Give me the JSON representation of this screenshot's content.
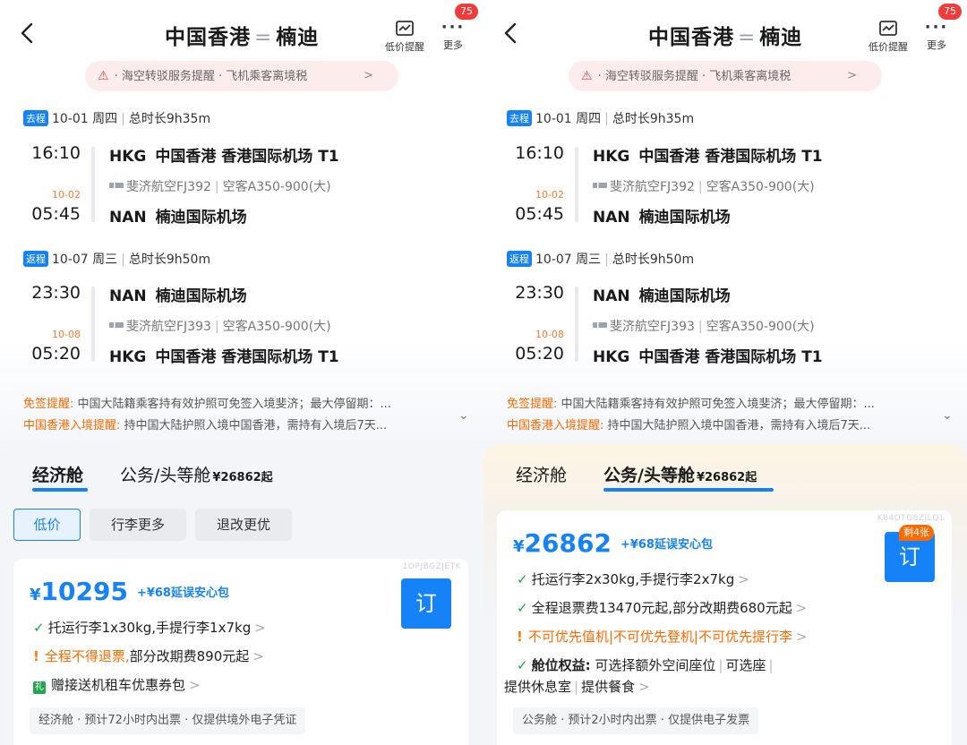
{
  "common": {
    "route_from": "中国香港",
    "route_sep": "=",
    "route_to": "楠迪",
    "lowprice_label": "低价提醒",
    "more_label": "更多",
    "badge_count": "75",
    "notice_text": "· 海空转驳服务提醒 · 飞机乘客离境税",
    "notice_arrow": ">",
    "outbound": {
      "tag": "去程",
      "date": "10-01 周四",
      "duration": "总时长9h35m",
      "dep_time": "16:10",
      "dep_code": "HKG",
      "dep_airport": "中国香港 香港国际机场 T1",
      "flight": "斐济航空FJ392",
      "aircraft": "空客A350-900(大)",
      "arr_next_day": "10-02",
      "arr_time": "05:45",
      "arr_code": "NAN",
      "arr_airport": "楠迪国际机场"
    },
    "inbound": {
      "tag": "返程",
      "date": "10-07 周三",
      "duration": "总时长9h50m",
      "dep_time": "23:30",
      "dep_code": "NAN",
      "dep_airport": "楠迪国际机场",
      "flight": "斐济航空FJ393",
      "aircraft": "空客A350-900(大)",
      "arr_next_day": "10-08",
      "arr_time": "05:20",
      "arr_code": "HKG",
      "arr_airport": "中国香港 香港国际机场 T1"
    },
    "visa1_label": "免签提醒:",
    "visa1_text": " 中国大陆籍乘客持有效护照可免签入境斐济；最大停留期：...",
    "visa2_label": "中国香港入境提醒:",
    "visa2_text": " 持中国大陆护照入境中国香港，需持有入境后7天...",
    "tab_economy": "经济舱",
    "tab_business": "公务/头等舱",
    "tab_business_price": "¥26862起"
  },
  "left": {
    "chip_lowprice": "低价",
    "chip_baggage": "行李更多",
    "chip_refund": "退改更优",
    "fare_code": "1OPJBGZJETK",
    "currency": "¥",
    "price": "10295",
    "price_extra": "+¥68延误安心包",
    "book_label": "订",
    "feat_baggage": "托运行李1x30kg,手提行李1x7kg",
    "feat_refund_warn": "全程不得退票,",
    "feat_refund_rest": "部分改期费890元起",
    "feat_gift": "赠接送机租车优惠券包",
    "foot_note": "经济舱 · 预计72小时内出票 · 仅提供境外电子凭证"
  },
  "right": {
    "fare_code": "K84OTG8ZJLQ1",
    "currency": "¥",
    "price": "26862",
    "price_extra": "+¥68延误安心包",
    "book_label": "订",
    "remain_badge": "剩4张",
    "feat_baggage": "托运行李2x30kg,手提行李2x7kg",
    "feat_refund": "全程退票费13470元起,部分改期费680元起",
    "feat_priority_warn": "不可优先值机|不可优先登机|不可优先提行李",
    "feat_rights_label": "舱位权益:",
    "feat_rights_text": " 可选择额外空间座位",
    "feat_rights_seat": "可选座",
    "feat_rights_line2a": "提供休息室",
    "feat_rights_line2b": "提供餐食",
    "foot_note": "公务舱 · 预计2小时内出票 · 仅提供电子发票"
  },
  "colors": {
    "accent": "#1583f7",
    "warning": "#ff6a00",
    "success": "#1ea74d",
    "badge": "#f23c3c"
  }
}
